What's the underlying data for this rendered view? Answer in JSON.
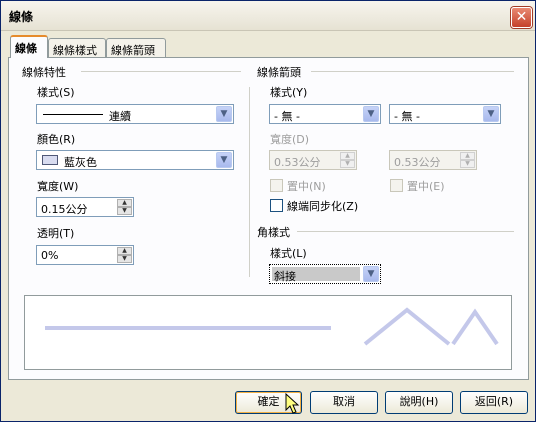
{
  "window": {
    "title": "線條",
    "close_label": "✕"
  },
  "tabs": [
    {
      "label": "線條",
      "active": true
    },
    {
      "label": "線條樣式",
      "active": false
    },
    {
      "label": "線條箭頭",
      "active": false
    }
  ],
  "line_props": {
    "section_title": "線條特性",
    "style_label": "樣式(S)",
    "style_value": "連續",
    "color_label": "顏色(R)",
    "color_value": "藍灰色",
    "color_swatch": "#d8dcf0",
    "width_label": "寬度(W)",
    "width_value": "0.15公分",
    "transparency_label": "透明(T)",
    "transparency_value": "0%"
  },
  "arrows": {
    "section_title": "線條箭頭",
    "style_label": "樣式(Y)",
    "left_style_value": "- 無 -",
    "right_style_value": "- 無 -",
    "width_label": "寬度(D)",
    "left_width_value": "0.53公分",
    "right_width_value": "0.53公分",
    "center_left_label": "置中(N)",
    "center_right_label": "置中(E)",
    "sync_label": "線端同步化(Z)"
  },
  "corner": {
    "section_title": "角樣式",
    "style_label": "樣式(L)",
    "style_value": "斜接"
  },
  "preview": {
    "line_color": "#c4c8ea"
  },
  "buttons": {
    "ok": "確定",
    "cancel": "取消",
    "help": "說明(H)",
    "reset": "返回(R)"
  }
}
